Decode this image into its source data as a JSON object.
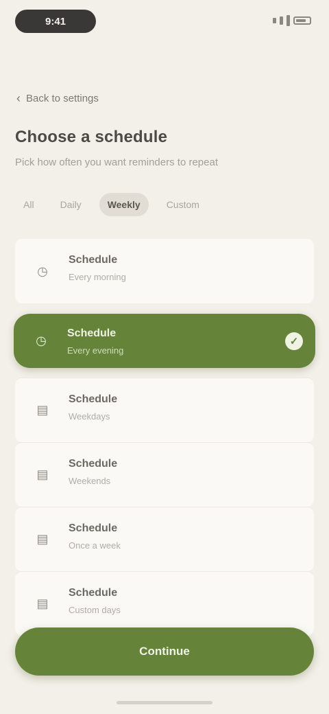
{
  "status_bar": {
    "time": "9:41"
  },
  "nav": {
    "back_label": "Back to settings"
  },
  "header": {
    "title": "Choose a schedule",
    "subtitle": "Pick how often you want reminders to repeat"
  },
  "filters": [
    {
      "label": "All"
    },
    {
      "label": "Daily"
    },
    {
      "label": "Weekly"
    },
    {
      "label": "Custom"
    }
  ],
  "options": [
    {
      "label": "Schedule",
      "sub": "Every morning",
      "icon": "clock-icon"
    },
    {
      "label": "Schedule",
      "sub": "Every evening",
      "icon": "clock-icon"
    },
    {
      "label": "Schedule",
      "sub": "Weekdays",
      "icon": "calendar-icon"
    },
    {
      "label": "Schedule",
      "sub": "Weekends",
      "icon": "calendar-icon"
    },
    {
      "label": "Schedule",
      "sub": "Once a week",
      "icon": "calendar-icon"
    },
    {
      "label": "Schedule",
      "sub": "Custom days",
      "icon": "calendar-icon"
    }
  ],
  "colors": {
    "accent": "#66833a",
    "background": "#f3efe9"
  },
  "primary_button": {
    "label": "Continue"
  }
}
